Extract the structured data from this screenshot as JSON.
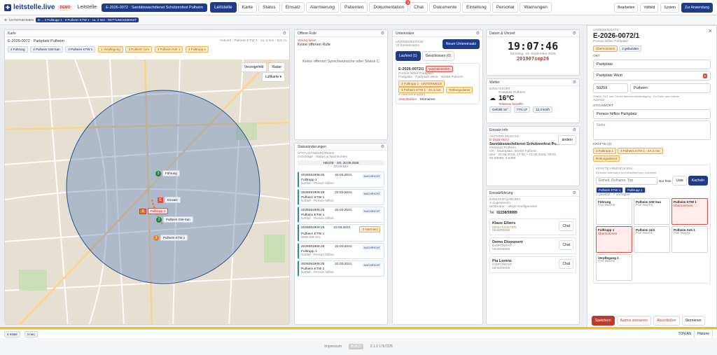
{
  "app": {
    "logo": "leitstelle.live",
    "demo": "DEMO",
    "leitstelle_link": "Leitstelle",
    "incident_pill": "E-2026-0072 · Sanitätswachdienst Schützenfest Pulheim"
  },
  "nav": [
    {
      "label": "Leitstelle",
      "active": true
    },
    {
      "label": "Karte"
    },
    {
      "label": "Status"
    },
    {
      "label": "Einsatz"
    },
    {
      "label": "Alarmierung"
    },
    {
      "label": "Patienten"
    },
    {
      "label": "Dokumentation",
      "badge": "3"
    },
    {
      "label": "Chat"
    },
    {
      "label": "Dokumente"
    },
    {
      "label": "Einteilung"
    },
    {
      "label": "Personal"
    },
    {
      "label": "Warnungen"
    }
  ],
  "top_right": [
    "Bearbeiten",
    "Vollbild",
    "System",
    "Zur Anwendung"
  ],
  "subbar": {
    "label": "UNTERNEHMEN",
    "pill": "E-... 2 Fulltrupp 1 · 3 Pulheim KTW 1 · ca. 2 min · RETTUNGSDIENST"
  },
  "map": {
    "title": "Karte",
    "incident": "E-2026-0072 · Parkplatz Pulheim",
    "eta": "Ankunft · Pulheim KTW 1 · ca. 2 min · 531 m",
    "chips": [
      {
        "label": "2 Führung"
      },
      {
        "label": "2 Pulheim GW-San"
      },
      {
        "label": "3 Pulheim KTW 1"
      },
      {
        "label": "1 Verpflegung",
        "orange": true
      },
      {
        "label": "3 Pulheim 11/1",
        "orange": true
      },
      {
        "label": "3 Pulheim Ash 1",
        "orange": true
      },
      {
        "label": "3 Fulltrupp 1",
        "orange": true
      }
    ],
    "controls": [
      "Verzeigefeld",
      "Radar"
    ],
    "layer": "Luftkarte",
    "markers": [
      {
        "label": "Führung",
        "num": "3"
      },
      {
        "label": "Einsatz",
        "num": "E"
      },
      {
        "label": "Pulheim GW-San",
        "num": "2"
      },
      {
        "label": "Pulheim KTW 1",
        "num": "3"
      },
      {
        "label": "Fulltrupp 1",
        "num": "3"
      }
    ]
  },
  "calls": {
    "title": "Offene Rufe",
    "status": "Streng leiser",
    "text": "Keine offenen Rufe",
    "empty": "Keine offenen Sprechwünsche oder Status C"
  },
  "status": {
    "title": "Statusänderungen",
    "sub": "STATUSÄNDERUNGEN",
    "sub2": "0 Einträge · Status & Nachrichten",
    "day": "HEUTE · SO, 20.09.2026",
    "time": "09:09 Uhr",
    "rows": [
      {
        "id": "2026091908:25",
        "date": "22.03.2021",
        "tag": "NACHRICHT",
        "name": "Fulltrupp 1",
        "note": "Notfall · Person hilflos"
      },
      {
        "id": "2026091908:25",
        "date": "22.03.2021",
        "tag": "NACHRICHT",
        "name": "Pulheim KTW 1",
        "note": "Notfall · Person hilflos"
      },
      {
        "id": "2026091908:25",
        "date": "22.03.2021",
        "tag": "NACHRICHT",
        "name": "Pulheim KTW 1",
        "note": "Notfall · Person hilflos"
      },
      {
        "id": "2026091908:25",
        "date": "22.03.2021",
        "tag": "3 Alarmiert",
        "name": "Pulheim KTW 1",
        "note": "BMR EB 101"
      },
      {
        "id": "2026091908:25",
        "date": "22.03.2021",
        "tag": "NACHRICHT",
        "name": "Fulltrupp 1",
        "note": "Notfall · Person hilflos"
      },
      {
        "id": "2026091908:25",
        "date": "22.03.2021",
        "tag": "NACHRICHT",
        "name": "Pulheim KTW 1",
        "note": "Notfall · Person hilflos"
      }
    ]
  },
  "units": {
    "title": "Unteinsätze",
    "sub": "UNTEREINSÄTZE",
    "sub2": "10 Einsatzsätze",
    "new_btn": "Neuer Untereinsatz",
    "tab_running": "Laufend (1)",
    "tab_closed": "Geschlossen (0)",
    "card": {
      "id": "E-2026-0072/1",
      "tag": "Wachdienstlich",
      "title": "Person hilflos Parkplatz",
      "addr": "Parkplatz · Parkplatz West · 50259 Pulheim",
      "chips": [
        {
          "label": "3 Fulltrupp 1 · UNTERWEGS"
        },
        {
          "label": "3 Pulheim KTW 1 · 4A 3 min"
        },
        {
          "label": "Rettungsdienst"
        }
      ],
      "count": "2 Alarmierung(en)",
      "abschliessen": "Abschließen",
      "stornieren": "Stornieren"
    }
  },
  "clock": {
    "title": "Datum & Uhrzeit",
    "time": "19:07:46",
    "date": "Samstag, 19. September 2026",
    "dtg": "201907sep26"
  },
  "weather": {
    "title": "Wetter",
    "loc": "EINSATZORT",
    "place": "Postplatz Pulheim",
    "temp": "16°C",
    "desc": "Teilweise bewölkt",
    "cells": [
      "Gefühlt 16°",
      "77% LF",
      "12,3 km/h"
    ]
  },
  "info": {
    "title": "Einsatz-Info",
    "label": "AKTIVER EINSATZ",
    "id": "E-2026-0072",
    "name": "Sanitätswachdienst Schützenfest Pu...",
    "place": "Festplatz Pulheim",
    "ort": "Ort · Marktplatz, 50259 Pulheim",
    "zeit": "Zeit · 20.09.2026, 17:00 – 21.09.2026, 03:02",
    "coords": "50.99999, 6.8499",
    "edit": "ändern"
  },
  "lead": {
    "title": "Einsatzführung",
    "label": "EINSATZFÜHRUNG",
    "count": "3 Zugewiesen",
    "sub": "Moderator · aktive Konfiguration",
    "tel_label": "Tel",
    "tel": "02238/59999",
    "people": [
      {
        "name": "Klaus Elbers",
        "role": "EINSATZLEITER",
        "tel": "0049/00000",
        "btn": "Chat"
      },
      {
        "name": "Demo Disponent",
        "role": "DISPONENT",
        "tel": "0049/00000",
        "btn": "Chat"
      },
      {
        "name": "Pia Lorenz",
        "role": "DISPONENT",
        "tel": "0049/00000",
        "btn": "Chat"
      }
    ]
  },
  "right": {
    "label": "UNTEREINSATZ",
    "id": "E-2026-0072/1",
    "title": "Person hilflos Parkplatz",
    "chip1": "Übernommen",
    "chip2": "2 gebunden",
    "ort": "ORT",
    "f1": "Parkplatz",
    "f2": "Parkplatz West",
    "plz": "50259",
    "city": "Pulheim",
    "hint": "Straße, PLZ und Ort mit Autovervollständigung · für Karte und Indizes",
    "adresse": "Adresse",
    "stichwort": "STICHWORT",
    "f3": "Person hilflos Parkplatz",
    "notiz": "Notiz",
    "kraefte": "KRÄFTE (3)",
    "kchips": [
      "3 Fulltrupp 1",
      "3 Pulheim KTW 1 · 4A 3 min"
    ],
    "rd": "Rettungsdienst",
    "add_label": "KRÄFTE HINZUFÜGEN",
    "add_sub": "Einheiten anfordern und einschließend zuweisen",
    "search_ph": "Einheit, Rufname, Typ",
    "nur_freie": "Nur freie",
    "liste": "Liste",
    "kacheln": "Kacheln",
    "chips2": [
      "Pulheim KTW 1",
      "Fulltrupp 1"
    ],
    "gewaehlt": "2 gewählt · 7 verfügbar",
    "tiles": [
      {
        "name": "Führung",
        "sub": "Frei Wache",
        "sel": false
      },
      {
        "name": "Pulheim GW-San",
        "sub": "Frei Wache",
        "sel": false
      },
      {
        "name": "Pulheim KTW 1",
        "sub": "Übernommen",
        "sel": true
      },
      {
        "name": "Fulltrupp 1",
        "sub": "Übernommen",
        "sel": true
      },
      {
        "name": "Pulheim 11/1",
        "sub": "Frei Wache",
        "sel": false
      },
      {
        "name": "Pulheim Ash 1",
        "sub": "Frei Wache",
        "sel": false
      },
      {
        "name": "Verpflegung 1",
        "sub": "Frei Wache",
        "sel": false
      }
    ],
    "save": "Speichern",
    "alarm": "Alarme stornieren",
    "close": "Abschließen",
    "cancel": "Stornieren"
  },
  "bottom": {
    "left": "4 mittel",
    "tag": "3 neu",
    "right1": "TON AN",
    "right2": "Historie"
  },
  "footer": {
    "impressum": "Impressum",
    "build": "BUILD",
    "version": "2.1.0 17b7225"
  }
}
